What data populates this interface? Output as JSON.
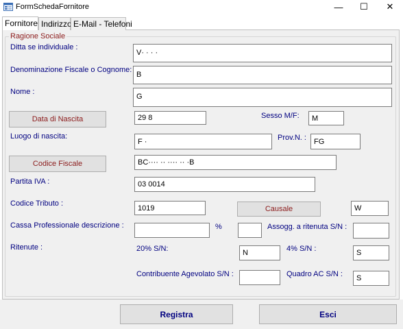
{
  "window": {
    "title": "FormSchedaFornitore",
    "minimize": "—",
    "maximize": "☐",
    "close": "✕"
  },
  "tabs": [
    "Fornitore",
    "Indirizzo",
    "E-Mail - Telefoni"
  ],
  "group_title": "Ragione Sociale",
  "labels": {
    "ditta": "Ditta se individuale :",
    "denominazione": "Denominazione Fiscale o Cognome:",
    "nome": "Nome :",
    "sesso": "Sesso M/F:",
    "luogo": "Luogo di nascita:",
    "prov": "Prov.N. :",
    "partita_iva": "Partita IVA :",
    "codice_tributo": "Codice Tributo  :",
    "cassa": "Cassa Professionale descrizione :",
    "percent": "%",
    "assogg": "Assogg. a ritenuta S/N :",
    "ritenute": "Ritenute :",
    "r20": "20% S/N:",
    "r4": "4% S/N :",
    "contribuente": "Contribuente Agevolato S/N :",
    "quadro": "Quadro AC  S/N :"
  },
  "buttons": {
    "data_nascita": "Data di Nascita",
    "codice_fiscale": "Codice Fiscale",
    "causale": "Causale",
    "registra": "Registra",
    "esci": "Esci"
  },
  "values": {
    "ditta": "V·  ·  ·  ·",
    "denominazione": "B",
    "nome": "G",
    "data_nascita": "29            8",
    "sesso": "M",
    "luogo": "F           ·",
    "prov": "FG",
    "codice_fiscale": "BC···· ·· ···· ·· ·B",
    "partita_iva": "03         0014",
    "codice_tributo": "1019",
    "causale": "W",
    "cassa": "",
    "assogg": "",
    "r20": "N",
    "r4": "S",
    "contribuente": "",
    "quadro": "S"
  }
}
